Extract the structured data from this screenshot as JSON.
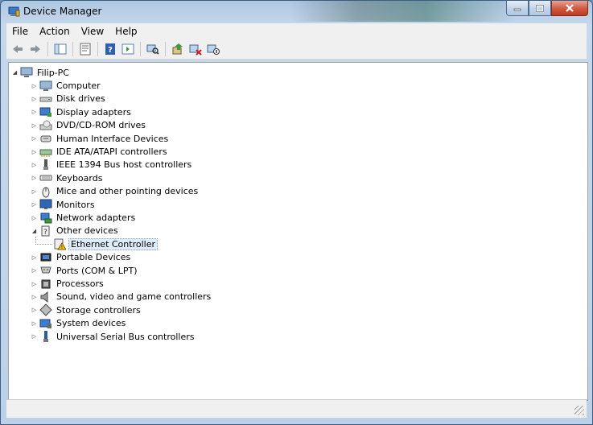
{
  "window": {
    "title": "Device Manager"
  },
  "menu": [
    "File",
    "Action",
    "View",
    "Help"
  ],
  "toolbar": [
    "back",
    "forward",
    "show-hide-console-tree",
    "properties",
    "help",
    "action-pane",
    "scan-hardware",
    "update-driver",
    "uninstall",
    "disable"
  ],
  "tree": {
    "root": "Filip-PC",
    "categories": [
      {
        "label": "Computer",
        "icon": "computer-icon"
      },
      {
        "label": "Disk drives",
        "icon": "disk-drive-icon"
      },
      {
        "label": "Display adapters",
        "icon": "display-adapter-icon"
      },
      {
        "label": "DVD/CD-ROM drives",
        "icon": "dvd-drive-icon"
      },
      {
        "label": "Human Interface Devices",
        "icon": "hid-icon"
      },
      {
        "label": "IDE ATA/ATAPI controllers",
        "icon": "ide-controller-icon"
      },
      {
        "label": "IEEE 1394 Bus host controllers",
        "icon": "firewire-icon"
      },
      {
        "label": "Keyboards",
        "icon": "keyboard-icon"
      },
      {
        "label": "Mice and other pointing devices",
        "icon": "mouse-icon"
      },
      {
        "label": "Monitors",
        "icon": "monitor-icon"
      },
      {
        "label": "Network adapters",
        "icon": "network-adapter-icon"
      },
      {
        "label": "Other devices",
        "icon": "other-devices-icon",
        "expanded": true
      },
      {
        "label": "Portable Devices",
        "icon": "portable-device-icon"
      },
      {
        "label": "Ports (COM & LPT)",
        "icon": "port-icon"
      },
      {
        "label": "Processors",
        "icon": "processor-icon"
      },
      {
        "label": "Sound, video and game controllers",
        "icon": "sound-icon"
      },
      {
        "label": "Storage controllers",
        "icon": "storage-controller-icon"
      },
      {
        "label": "System devices",
        "icon": "system-device-icon"
      },
      {
        "label": "Universal Serial Bus controllers",
        "icon": "usb-icon"
      }
    ],
    "other_devices_child": {
      "label": "Ethernet Controller",
      "icon": "warning-device-icon"
    }
  }
}
